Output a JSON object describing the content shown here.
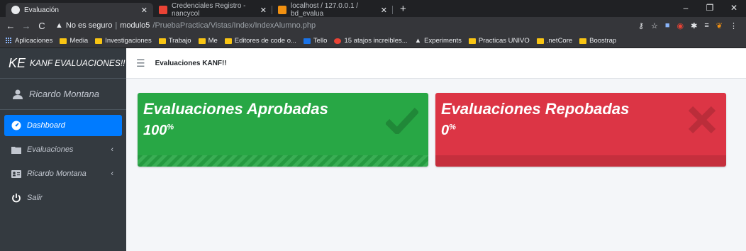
{
  "browser": {
    "tabs": [
      {
        "label": "Evaluación",
        "active": true
      },
      {
        "label": "Credenciales Registro - nancycol",
        "active": false
      },
      {
        "label": "localhost / 127.0.0.1 / bd_evalua",
        "active": false
      }
    ],
    "new_tab": "+",
    "url": {
      "security": "No es seguro",
      "host": "modulo5",
      "path": "/PruebaPractica/Vistas/Index/IndexAlumno.php"
    },
    "bookmarks": [
      "Aplicaciones",
      "Media",
      "Investigaciones",
      "Trabajo",
      "Me",
      "Editores de code o...",
      "Tello",
      "15 atajos increibles...",
      "Experiments",
      "Practicas UNIVO",
      ".netCore",
      "Boostrap"
    ]
  },
  "sidebar": {
    "brand_logo": "KE",
    "brand_name": "KANF EVALUACIONES!!",
    "user_name": "Ricardo Montana",
    "items": [
      {
        "label": "Dashboard",
        "icon": "dashboard-icon"
      },
      {
        "label": "Evaluaciones",
        "icon": "folder-icon"
      },
      {
        "label": "Ricardo Montana",
        "icon": "id-card-icon"
      },
      {
        "label": "Salir",
        "icon": "power-icon"
      }
    ]
  },
  "header": {
    "title": "Evaluaciones KANF!!"
  },
  "cards": [
    {
      "title": "Evaluaciones Aprobadas",
      "value": "100",
      "unit": "%",
      "color": "#28a745",
      "icon": "check-icon"
    },
    {
      "title": "Evaluaciones Repobadas",
      "value": "0",
      "unit": "%",
      "color": "#dc3545",
      "icon": "x-icon"
    }
  ]
}
